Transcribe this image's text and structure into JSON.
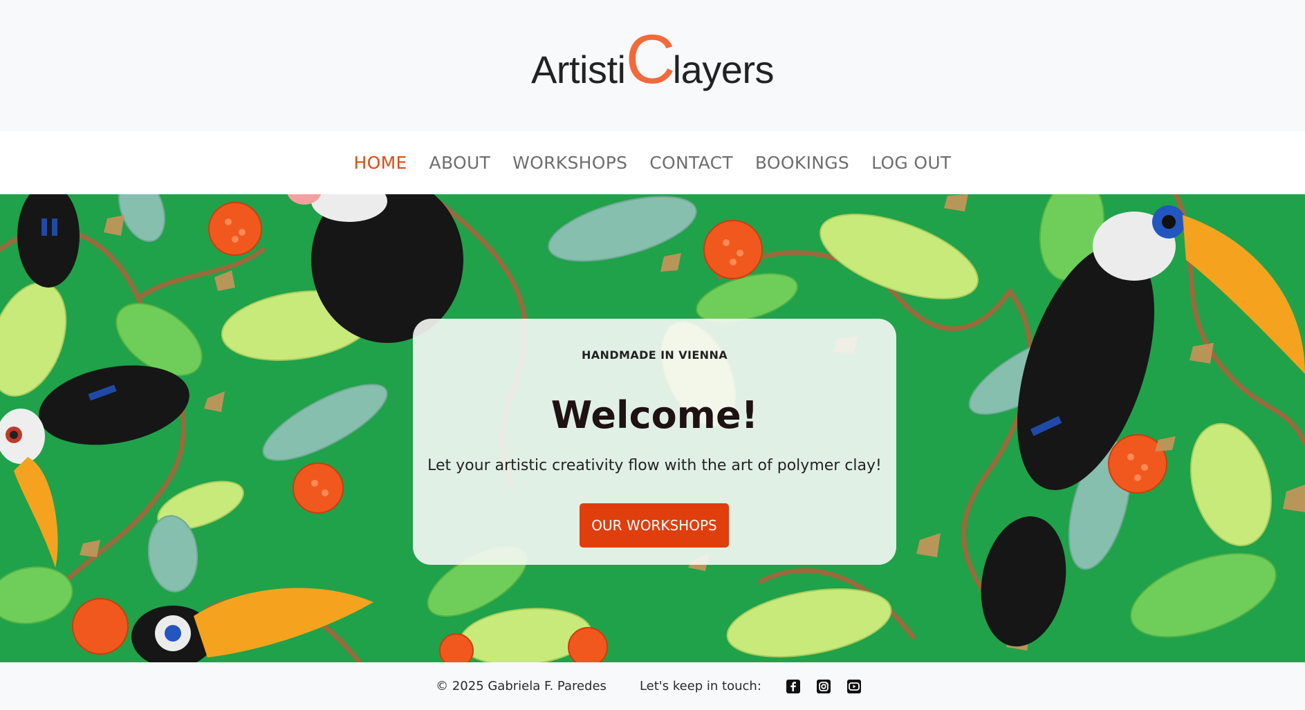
{
  "brand": {
    "part1": "Artisti",
    "part2": "C",
    "part3": "layers",
    "accent_color": "#f26a3a"
  },
  "nav": {
    "items": [
      {
        "label": "HOME",
        "active": true
      },
      {
        "label": "ABOUT",
        "active": false
      },
      {
        "label": "WORKSHOPS",
        "active": false
      },
      {
        "label": "CONTACT",
        "active": false
      },
      {
        "label": "BOOKINGS",
        "active": false
      },
      {
        "label": "LOG OUT",
        "active": false
      }
    ],
    "active_color": "#e04a12",
    "inactive_color": "#6e6e6e"
  },
  "hero": {
    "eyebrow": "HANDMADE IN VIENNA",
    "title": "Welcome!",
    "subtitle": "Let your artistic creativity flow with the art of polymer clay!",
    "cta_label": "OUR WORKSHOPS",
    "cta_color": "#e03e0c",
    "background_color": "#1fa24a"
  },
  "footer": {
    "copyright": "© 2025 Gabriela F. Paredes",
    "touch_label": "Let's keep in touch:",
    "social_icons": [
      "facebook-icon",
      "instagram-icon",
      "youtube-icon"
    ]
  }
}
